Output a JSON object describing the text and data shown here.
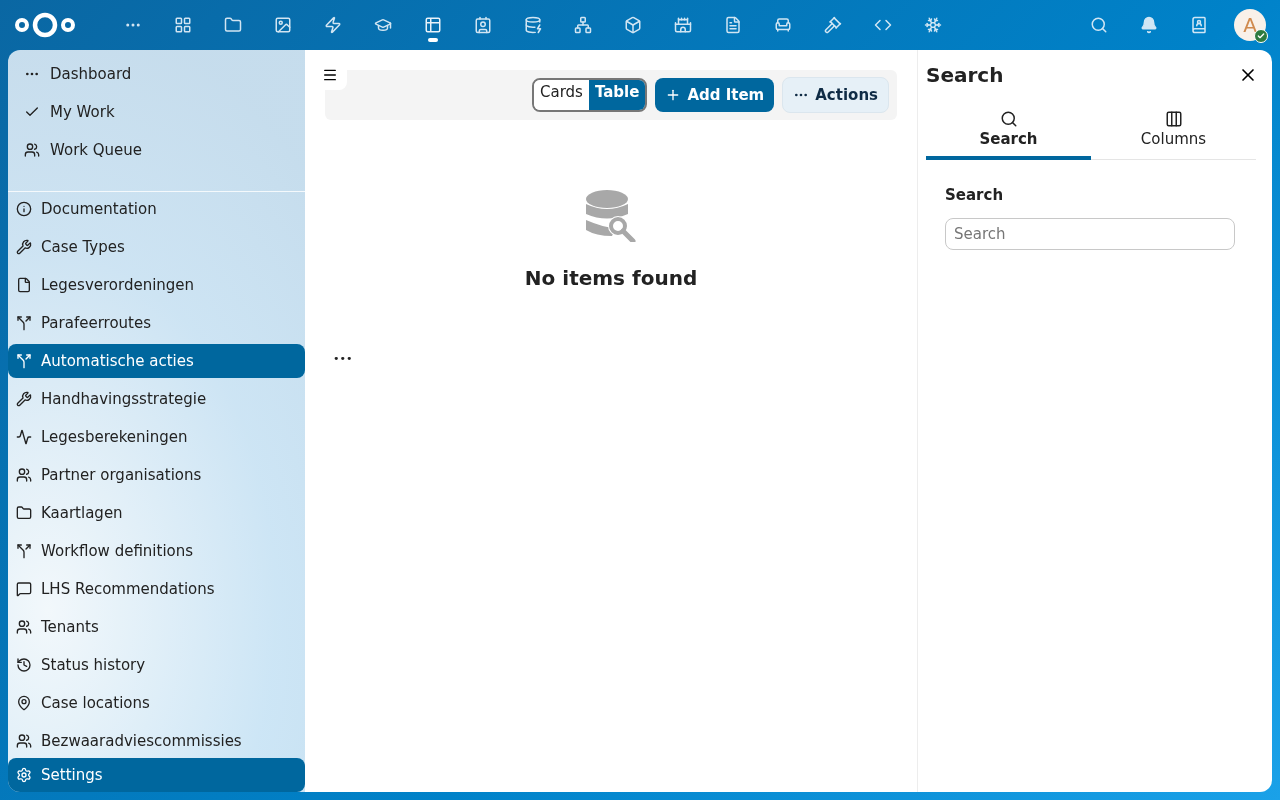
{
  "top_bar": {
    "apps": [
      {
        "selected": false
      },
      {
        "selected": false
      },
      {
        "selected": false
      },
      {
        "selected": false
      },
      {
        "selected": false
      },
      {
        "selected": false
      },
      {
        "selected": true
      },
      {
        "selected": false
      },
      {
        "selected": false
      },
      {
        "selected": false
      },
      {
        "selected": false
      },
      {
        "selected": false
      },
      {
        "selected": false
      },
      {
        "selected": false
      },
      {
        "selected": false
      },
      {
        "selected": false
      },
      {
        "selected": false
      }
    ],
    "avatar": {
      "letter": "A",
      "online": true
    }
  },
  "sidebar": {
    "top_items": [
      {
        "label": "Dashboard"
      },
      {
        "label": "My Work"
      },
      {
        "label": "Work Queue"
      }
    ],
    "items": [
      {
        "label": "Documentation",
        "selected": false
      },
      {
        "label": "Case Types",
        "selected": false
      },
      {
        "label": "Legesverordeningen",
        "selected": false
      },
      {
        "label": "Parafeerroutes",
        "selected": false
      },
      {
        "label": "Automatische acties",
        "selected": true
      },
      {
        "label": "Handhavingsstrategie",
        "selected": false
      },
      {
        "label": "Legesberekeningen",
        "selected": false
      },
      {
        "label": "Partner organisations",
        "selected": false
      },
      {
        "label": "Kaartlagen",
        "selected": false
      },
      {
        "label": "Workflow definitions",
        "selected": false
      },
      {
        "label": "LHS Recommendations",
        "selected": false
      },
      {
        "label": "Tenants",
        "selected": false
      },
      {
        "label": "Status history",
        "selected": false
      },
      {
        "label": "Case locations",
        "selected": false
      },
      {
        "label": "Bezwaaradviescommissies",
        "selected": false
      }
    ],
    "settings": {
      "label": "Settings",
      "selected": true
    }
  },
  "main": {
    "view_toggle": [
      {
        "label": "Cards",
        "selected": false
      },
      {
        "label": "Table",
        "selected": true
      }
    ],
    "add_button": "Add Item",
    "actions_button": "Actions",
    "empty_state": "No items found",
    "more": "•••"
  },
  "panel": {
    "title": "Search",
    "tabs": [
      {
        "label": "Search",
        "selected": true
      },
      {
        "label": "Columns",
        "selected": false
      }
    ],
    "field_label": "Search",
    "search": {
      "placeholder": "Search"
    }
  }
}
